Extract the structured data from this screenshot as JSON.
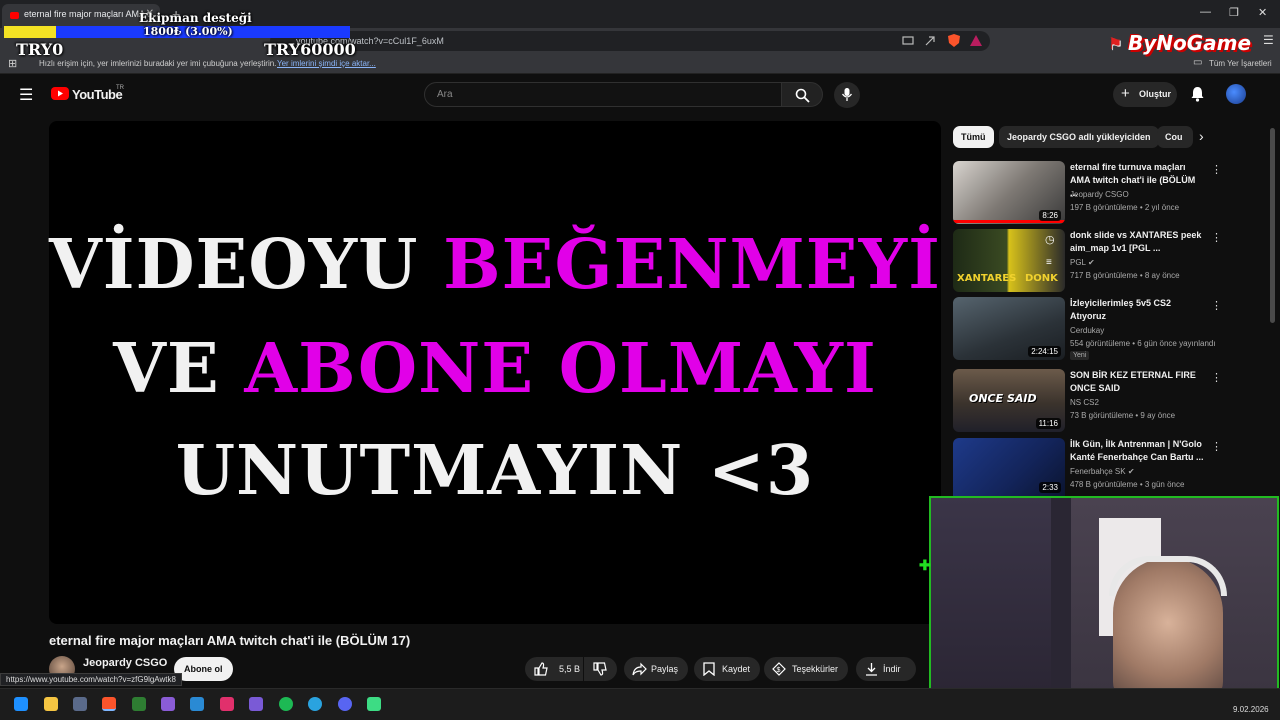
{
  "browser": {
    "tab_title": "eternal fire major maçları AMA t",
    "url": "youtube.com/watch?v=cCul1F_6uxM",
    "bookmarks_hint": "Hızlı erişim için, yer imlerinizi buradaki yer imi çubuğuna yerleştirin.",
    "bookmarks_link": "Yer imlerini şimdi içe aktar...",
    "all_bookmarks": "Tüm Yer İşaretleri",
    "status_url": "https://www.youtube.com/watch?v=zfG9lgAwtk8"
  },
  "overlay": {
    "donation_label": "Ekipman desteği",
    "donation_value": "1800₺ (3.00%)",
    "donation_progress": 0.03,
    "left_amount": "TRY0",
    "right_amount": "TRY60000",
    "brand": "ByNoGame"
  },
  "youtube": {
    "logo_text": "YouTube",
    "logo_region": "TR",
    "search_placeholder": "Ara",
    "create_label": "Oluştur",
    "player_lines": {
      "line1_white": "VİDEOYU ",
      "line1_magenta": "BEĞENMEYİ",
      "line2_white": "VE ",
      "line2_magenta": "ABONE OLMAYI",
      "line3_white": "UNUTMAYIN <3"
    },
    "video_title": "eternal fire major maçları AMA twitch chat'i ile (BÖLÜM 17)",
    "channel_name": "Jeopardy CSGO",
    "subscribe_label": "Abone ol",
    "like_count": "5,5 B",
    "share_label": "Paylaş",
    "save_label": "Kaydet",
    "thanks_label": "Teşekkürler",
    "download_label": "İndir",
    "chips": [
      "Tümü",
      "Jeopardy CSGO adlı yükleyiciden",
      "Cou"
    ],
    "recommendations": [
      {
        "title": "eternal fire turnuva maçları AMA twitch chat'i ile (BÖLÜM ...",
        "channel": "Jeopardy CSGO",
        "meta": "197 B görüntüleme • 2 yıl önce",
        "duration": "8:26"
      },
      {
        "title": "donk slide vs XANTARES peek aim_map 1v1 [PGL ...",
        "channel": "PGL",
        "meta": "717 B görüntüleme • 8 ay önce",
        "duration": ""
      },
      {
        "title": "İzleyicilerimleş 5v5 CS2 Atıyoruz",
        "channel": "Cerdukay",
        "meta": "554 görüntüleme • 6 gün önce yayınlandı",
        "duration": "2:24:15",
        "badge": "Yeni"
      },
      {
        "title": "SON BİR KEZ ETERNAL FIRE ONCE SAID",
        "channel": "NS CS2",
        "meta": "73 B görüntüleme • 9 ay önce",
        "duration": "11:16"
      },
      {
        "title": "İlk Gün, İlk Antrenman | N'Golo Kanté Fenerbahçe Can Bartu ...",
        "channel": "Fenerbahçe SK",
        "meta": "478 B görüntüleme • 3 gün önce",
        "duration": "2:33"
      }
    ],
    "thumb_text": {
      "xantares": "XANTARES",
      "donk": "DONK",
      "once_said": "ONCE SAID"
    }
  },
  "taskbar": {
    "date": "9.02.2026"
  },
  "colors": {
    "yt_red": "#ff0000",
    "magenta": "#e100e8",
    "donation_bar": "#1a3aff",
    "donation_fill": "#f4e224",
    "cam_border": "#22bb22"
  }
}
